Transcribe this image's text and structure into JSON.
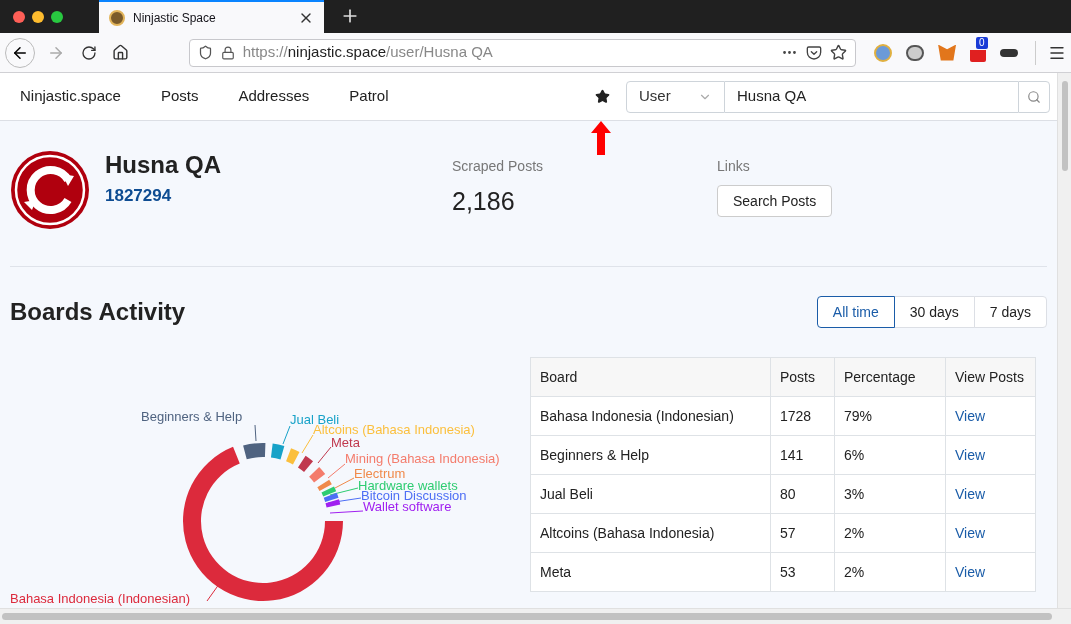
{
  "browser": {
    "tab": {
      "title": "Ninjastic Space"
    },
    "url": {
      "scheme": "https://",
      "host": "ninjastic.space",
      "path": "/user/Husna QA"
    },
    "extension_badge": "0"
  },
  "navbar": {
    "links": [
      "Ninjastic.space",
      "Posts",
      "Addresses",
      "Patrol"
    ],
    "search": {
      "type": "User",
      "value": "Husna QA"
    }
  },
  "profile": {
    "name": "Husna QA",
    "id": "1827294",
    "stat_label": "Scraped Posts",
    "stat_value": "2,186",
    "links_label": "Links",
    "links_button": "Search Posts"
  },
  "boards": {
    "title": "Boards Activity",
    "ranges": [
      {
        "label": "All time",
        "selected": true
      },
      {
        "label": "30 days",
        "selected": false
      },
      {
        "label": "7 days",
        "selected": false
      }
    ],
    "chart_labels": [
      {
        "label": "Bahasa Indonesia (Indonesian)",
        "color": "#dc2a3c"
      },
      {
        "label": "Beginners & Help",
        "color": "#4f6380"
      },
      {
        "label": "Jual Beli",
        "color": "#17a2c8"
      },
      {
        "label": "Altcoins (Bahasa Indonesia)",
        "color": "#fbbf3c"
      },
      {
        "label": "Meta",
        "color": "#c0394e"
      },
      {
        "label": "Mining (Bahasa Indonesia)",
        "color": "#f47c6c"
      },
      {
        "label": "Electrum",
        "color": "#f08a4b"
      },
      {
        "label": "Hardware wallets",
        "color": "#2ecc71"
      },
      {
        "label": "Bitcoin Discussion",
        "color": "#4d6ef5"
      },
      {
        "label": "Wallet software",
        "color": "#a020f0"
      }
    ],
    "table": {
      "columns": [
        "Board",
        "Posts",
        "Percentage",
        "View Posts"
      ],
      "rows": [
        {
          "board": "Bahasa Indonesia (Indonesian)",
          "posts": "1728",
          "percentage": "79%",
          "link": "View"
        },
        {
          "board": "Beginners & Help",
          "posts": "141",
          "percentage": "6%",
          "link": "View"
        },
        {
          "board": "Jual Beli",
          "posts": "80",
          "percentage": "3%",
          "link": "View"
        },
        {
          "board": "Altcoins (Bahasa Indonesia)",
          "posts": "57",
          "percentage": "2%",
          "link": "View"
        },
        {
          "board": "Meta",
          "posts": "53",
          "percentage": "2%",
          "link": "View"
        }
      ]
    }
  }
}
